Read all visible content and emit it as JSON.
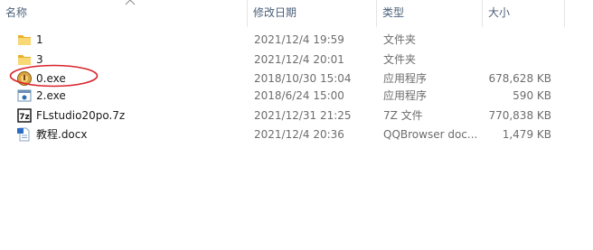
{
  "columns": {
    "name": "名称",
    "date": "修改日期",
    "type": "类型",
    "size": "大小"
  },
  "files": [
    {
      "name": "1",
      "date": "2021/12/4 19:59",
      "type": "文件夹",
      "size": "",
      "icon": "folder-icon"
    },
    {
      "name": "3",
      "date": "2021/12/4 20:01",
      "type": "文件夹",
      "size": "",
      "icon": "folder-icon"
    },
    {
      "name": "0.exe",
      "date": "2018/10/30 15:04",
      "type": "应用程序",
      "size": "678,628 KB",
      "icon": "exe-app-icon"
    },
    {
      "name": "2.exe",
      "date": "2018/6/24 15:00",
      "type": "应用程序",
      "size": "590 KB",
      "icon": "exe-app-icon"
    },
    {
      "name": "FLstudio20po.7z",
      "date": "2021/12/31 21:25",
      "type": "7Z 文件",
      "size": "770,838 KB",
      "icon": "7z-archive-icon"
    },
    {
      "name": "教程.docx",
      "date": "2021/12/4 20:36",
      "type": "QQBrowser doc...",
      "size": "1,479 KB",
      "icon": "docx-document-icon"
    }
  ],
  "colors": {
    "header_text": "#4c607a",
    "folder": "#f5c542",
    "annotation": "#d9232d"
  }
}
